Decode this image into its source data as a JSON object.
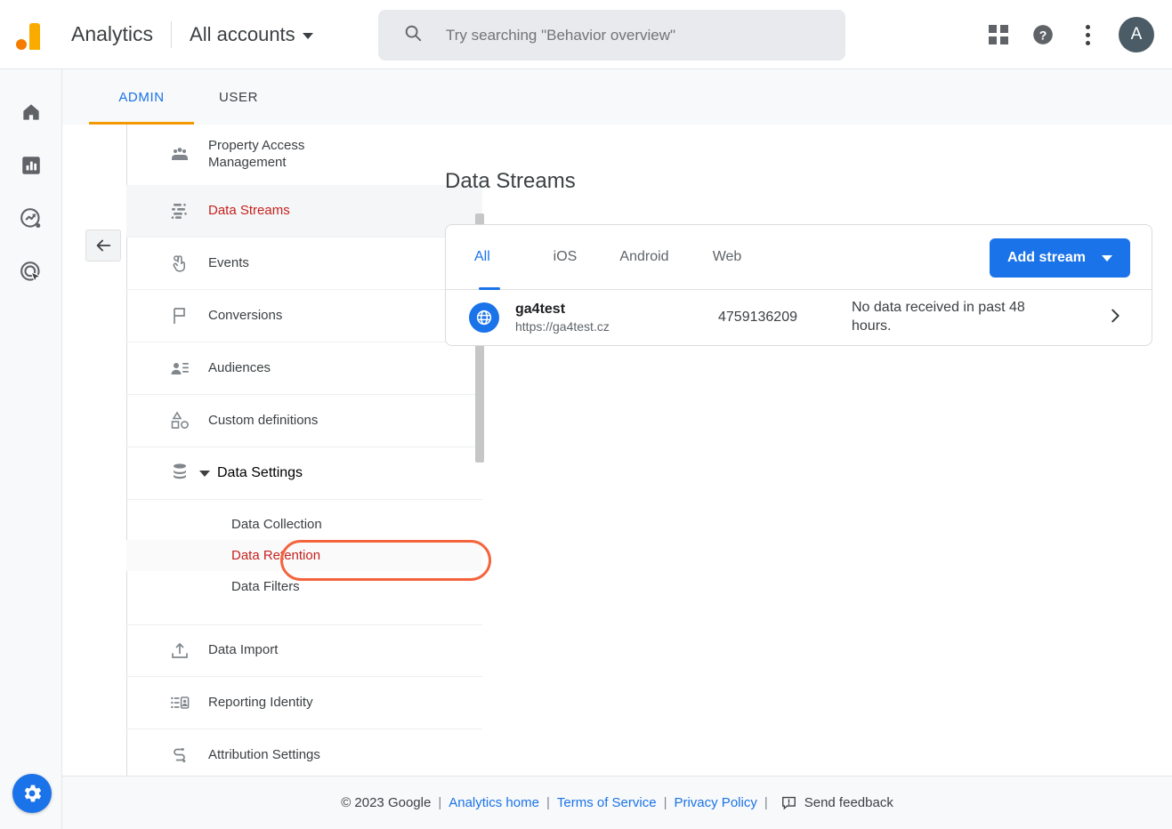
{
  "header": {
    "brand": "Analytics",
    "account_selector": "All accounts",
    "search_placeholder": "Try searching \"Behavior overview\"",
    "search_value": "",
    "avatar_initial": "A",
    "icons": {
      "search": "search-icon",
      "apps": "apps-grid-icon",
      "help": "help-icon",
      "more": "more-vert-icon"
    }
  },
  "rail": {
    "items": [
      {
        "name": "home",
        "icon": "home-icon"
      },
      {
        "name": "reports",
        "icon": "bar-chart-icon"
      },
      {
        "name": "explore",
        "icon": "explore-trend-icon"
      },
      {
        "name": "advertising",
        "icon": "advertising-target-icon"
      }
    ],
    "admin_button_icon": "gear-icon"
  },
  "tabs": [
    {
      "label": "ADMIN",
      "selected": true
    },
    {
      "label": "USER",
      "selected": false
    }
  ],
  "sidebar": {
    "back_button_icon": "arrow-left-icon",
    "items": [
      {
        "label": "Property Access Management",
        "icon": "people-group-icon",
        "active": false
      },
      {
        "label": "Data Streams",
        "icon": "data-streams-icon",
        "active": true
      },
      {
        "label": "Events",
        "icon": "touch-event-icon",
        "active": false
      },
      {
        "label": "Conversions",
        "icon": "flag-icon",
        "active": false
      },
      {
        "label": "Audiences",
        "icon": "audience-person-icon",
        "active": false
      },
      {
        "label": "Custom definitions",
        "icon": "shapes-icon",
        "active": false
      }
    ],
    "data_settings": {
      "label": "Data Settings",
      "icon": "database-icon",
      "expanded": true,
      "sub_items": [
        {
          "label": "Data Collection",
          "active": false
        },
        {
          "label": "Data Retention",
          "active": true,
          "highlighted": true
        },
        {
          "label": "Data Filters",
          "active": false
        }
      ]
    },
    "items_after": [
      {
        "label": "Data Import",
        "icon": "upload-icon",
        "active": false
      },
      {
        "label": "Reporting Identity",
        "icon": "reporting-identity-icon",
        "active": false
      },
      {
        "label": "Attribution Settings",
        "icon": "attribution-path-icon",
        "active": false
      }
    ]
  },
  "main": {
    "page_title": "Data Streams",
    "filter_tabs": [
      {
        "label": "All",
        "selected": true
      },
      {
        "label": "iOS",
        "selected": false
      },
      {
        "label": "Android",
        "selected": false
      },
      {
        "label": "Web",
        "selected": false
      }
    ],
    "add_stream_label": "Add stream",
    "streams": [
      {
        "icon": "globe-web-icon",
        "name": "ga4test",
        "url": "https://ga4test.cz",
        "measurement_id": "4759136209",
        "status": "No data received in past 48 hours."
      }
    ]
  },
  "footer": {
    "copyright": "© 2023 Google",
    "links": [
      {
        "label": "Analytics home"
      },
      {
        "label": "Terms of Service"
      },
      {
        "label": "Privacy Policy"
      }
    ],
    "feedback_label": "Send feedback",
    "feedback_icon": "feedback-icon"
  },
  "colors": {
    "accent_blue": "#1a73e8",
    "active_red": "#c5221f",
    "annotation_orange": "#f4643c",
    "tab_underline_orange": "#f29900",
    "logo_orange": "#f57c00",
    "logo_yellow": "#f9ab00"
  }
}
